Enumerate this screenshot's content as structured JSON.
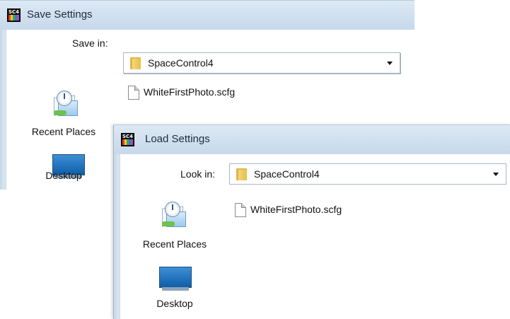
{
  "save_dialog": {
    "icon_label": "SC4",
    "title": "Save Settings",
    "location_label": "Save in:",
    "location_value": "SpaceControl4",
    "places": [
      "Recent Places",
      "Desktop"
    ],
    "files": [
      "WhiteFirstPhoto.scfg"
    ]
  },
  "load_dialog": {
    "icon_label": "SC4",
    "title": "Load Settings",
    "location_label": "Look in:",
    "location_value": "SpaceControl4",
    "places": [
      "Recent Places",
      "Desktop"
    ],
    "files": [
      "WhiteFirstPhoto.scfg"
    ]
  },
  "colors": {
    "titlebar_top": "#dde9f4",
    "titlebar_bottom": "#c6d8ea",
    "folder": "#e9be4a",
    "desktop_screen": "#1f6fb8"
  },
  "icons": [
    "app-icon",
    "folder-icon",
    "recent-places-icon",
    "desktop-icon",
    "file-icon",
    "dropdown-arrow-icon"
  ]
}
